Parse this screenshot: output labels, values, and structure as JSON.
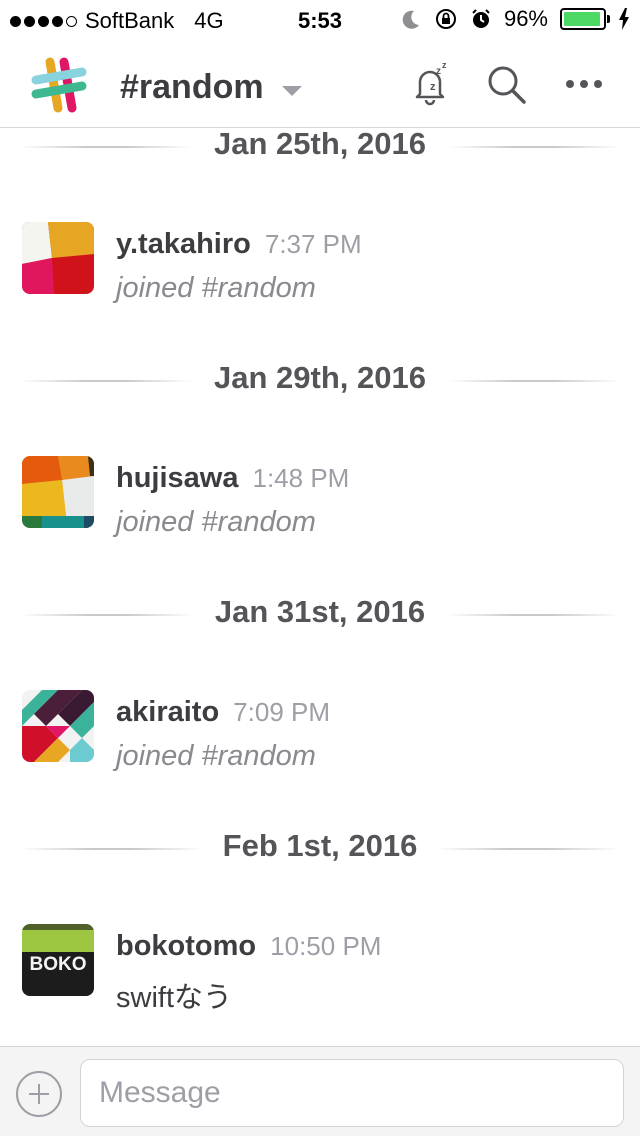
{
  "status_bar": {
    "carrier": "SoftBank",
    "network": "4G",
    "time": "5:53",
    "battery": "96%",
    "battery_level": 0.96
  },
  "header": {
    "channel": "#random",
    "icons": [
      "slack-logo-icon",
      "snooze-bell-icon",
      "search-icon",
      "more-icon"
    ]
  },
  "days": [
    {
      "date": "Jan 25th, 2016",
      "message": {
        "user": "y.takahiro",
        "time": "7:37 PM",
        "text": "joined #random",
        "type": "joined"
      }
    },
    {
      "date": "Jan 29th, 2016",
      "message": {
        "user": "hujisawa",
        "time": "1:48 PM",
        "text": "joined #random",
        "type": "joined"
      }
    },
    {
      "date": "Jan 31st, 2016",
      "message": {
        "user": "akiraito",
        "time": "7:09 PM",
        "text": "joined #random",
        "type": "joined"
      }
    },
    {
      "date": "Feb 1st, 2016",
      "message": {
        "user": "bokotomo",
        "time": "10:50 PM",
        "text": "swiftなう",
        "type": "text"
      }
    }
  ],
  "avatar_texts": {
    "bokotomo": "BOKO"
  },
  "composer": {
    "placeholder": "Message"
  },
  "colors": {
    "accent_green": "#4cd964",
    "text_dark": "#3d3c40",
    "text_muted": "#9e9ea6"
  }
}
